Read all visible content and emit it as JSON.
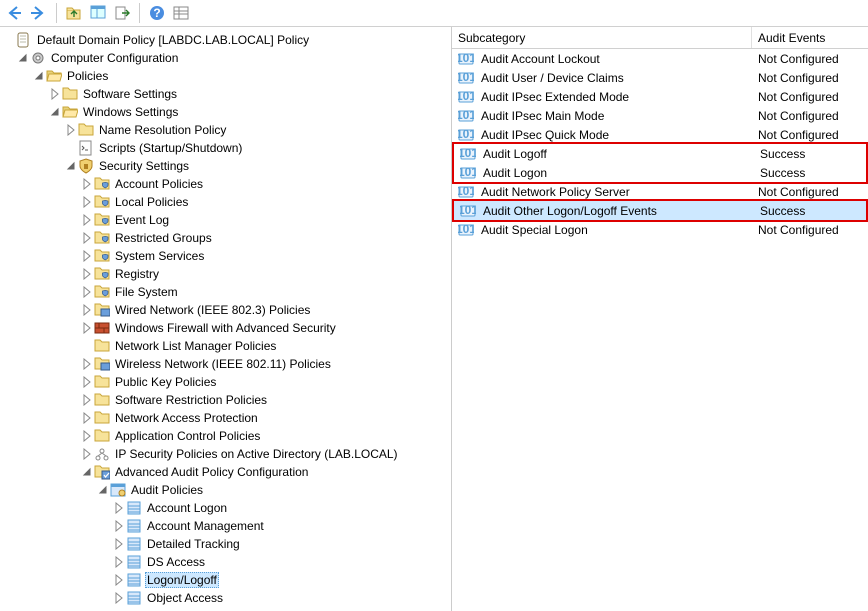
{
  "toolbar": [
    "back",
    "forward",
    "|",
    "up",
    "props",
    "export",
    "|",
    "help",
    "views"
  ],
  "tree_root": "Default Domain Policy [LABDC.LAB.LOCAL] Policy",
  "computer_config": "Computer Configuration",
  "policies": "Policies",
  "software_settings": "Software Settings",
  "windows_settings": "Windows Settings",
  "nrp": "Name Resolution Policy",
  "scripts": "Scripts (Startup/Shutdown)",
  "security_settings": "Security Settings",
  "sec_children": [
    "Account Policies",
    "Local Policies",
    "Event Log",
    "Restricted Groups",
    "System Services",
    "Registry",
    "File System",
    "Wired Network (IEEE 802.3) Policies",
    "Windows Firewall with Advanced Security",
    "Network List Manager Policies",
    "Wireless Network (IEEE 802.11) Policies",
    "Public Key Policies",
    "Software Restriction Policies",
    "Network Access Protection",
    "Application Control Policies",
    "IP Security Policies on Active Directory (LAB.LOCAL)",
    "Advanced Audit Policy Configuration"
  ],
  "audit_policies": "Audit Policies",
  "audit_children": [
    "Account Logon",
    "Account Management",
    "Detailed Tracking",
    "DS Access",
    "Logon/Logoff",
    "Object Access"
  ],
  "list_header": {
    "sub": "Subcategory",
    "ae": "Audit Events"
  },
  "rows": [
    {
      "name": "Audit Account Lockout",
      "val": "Not Configured",
      "hl": false
    },
    {
      "name": "Audit User / Device Claims",
      "val": "Not Configured",
      "hl": false
    },
    {
      "name": "Audit IPsec Extended Mode",
      "val": "Not Configured",
      "hl": false
    },
    {
      "name": "Audit IPsec Main Mode",
      "val": "Not Configured",
      "hl": false
    },
    {
      "name": "Audit IPsec Quick Mode",
      "val": "Not Configured",
      "hl": false
    },
    {
      "name": "Audit Logoff",
      "val": "Success",
      "hl": "g1"
    },
    {
      "name": "Audit Logon",
      "val": "Success",
      "hl": "g1"
    },
    {
      "name": "Audit Network Policy Server",
      "val": "Not Configured",
      "hl": false
    },
    {
      "name": "Audit Other Logon/Logoff Events",
      "val": "Success",
      "hl": "g2",
      "sel": true
    },
    {
      "name": "Audit Special Logon",
      "val": "Not Configured",
      "hl": false
    }
  ]
}
